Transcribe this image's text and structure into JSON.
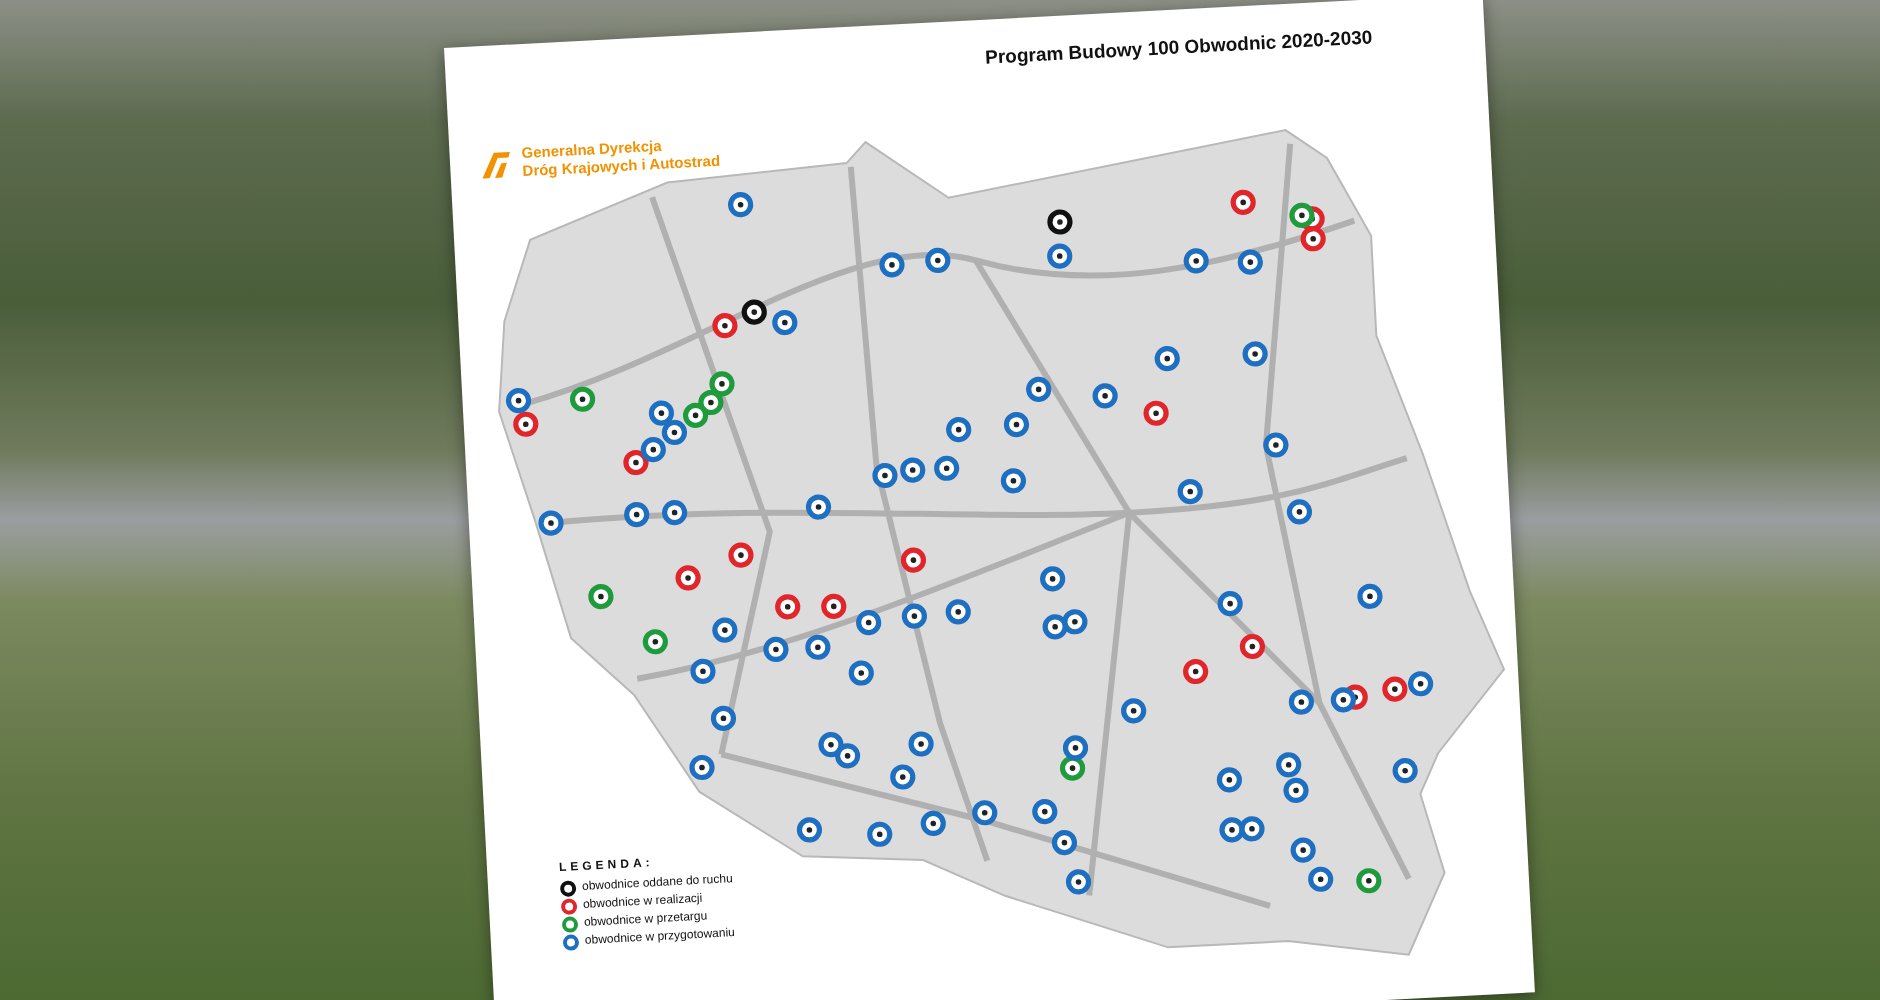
{
  "poster": {
    "title": "Program Budowy 100 Obwodnic 2020-2030",
    "logo": {
      "lines": [
        "Generalna Dyrekcja",
        "Dróg Krajowych i Autostrad"
      ]
    },
    "legend": {
      "title": "LEGENDA:",
      "items": [
        {
          "kind": "open",
          "label": "obwodnice oddane do ruchu",
          "color": "#111111"
        },
        {
          "kind": "construction",
          "label": "obwodnice w realizacji",
          "color": "#e0262b"
        },
        {
          "kind": "tender",
          "label": "obwodnice w przetargu",
          "color": "#1f9a3c"
        },
        {
          "kind": "preparation",
          "label": "obwodnice w przygotowaniu",
          "color": "#1f6fc0"
        }
      ]
    },
    "markers": [
      {
        "kind": "open"
      },
      {
        "kind": "open"
      },
      {
        "kind": "construction"
      },
      {
        "kind": "construction"
      },
      {
        "kind": "construction"
      },
      {
        "kind": "construction"
      },
      {
        "kind": "construction"
      },
      {
        "kind": "construction"
      },
      {
        "kind": "construction"
      },
      {
        "kind": "construction"
      },
      {
        "kind": "construction"
      },
      {
        "kind": "construction"
      },
      {
        "kind": "construction"
      },
      {
        "kind": "construction"
      },
      {
        "kind": "construction"
      },
      {
        "kind": "construction"
      },
      {
        "kind": "construction"
      },
      {
        "kind": "construction"
      },
      {
        "kind": "tender"
      },
      {
        "kind": "tender"
      },
      {
        "kind": "tender"
      },
      {
        "kind": "tender"
      },
      {
        "kind": "tender"
      },
      {
        "kind": "tender"
      },
      {
        "kind": "tender"
      },
      {
        "kind": "tender"
      },
      {
        "kind": "tender"
      },
      {
        "kind": "preparation"
      },
      {
        "kind": "preparation"
      },
      {
        "kind": "preparation"
      },
      {
        "kind": "preparation"
      },
      {
        "kind": "preparation"
      },
      {
        "kind": "preparation"
      },
      {
        "kind": "preparation"
      },
      {
        "kind": "preparation"
      },
      {
        "kind": "preparation"
      },
      {
        "kind": "preparation"
      },
      {
        "kind": "preparation"
      },
      {
        "kind": "preparation"
      },
      {
        "kind": "preparation"
      },
      {
        "kind": "preparation"
      },
      {
        "kind": "preparation"
      },
      {
        "kind": "preparation"
      },
      {
        "kind": "preparation"
      },
      {
        "kind": "preparation"
      },
      {
        "kind": "preparation"
      },
      {
        "kind": "preparation"
      },
      {
        "kind": "preparation"
      },
      {
        "kind": "preparation"
      },
      {
        "kind": "preparation"
      },
      {
        "kind": "preparation"
      },
      {
        "kind": "preparation"
      },
      {
        "kind": "preparation"
      },
      {
        "kind": "preparation"
      },
      {
        "kind": "preparation"
      },
      {
        "kind": "preparation"
      },
      {
        "kind": "preparation"
      },
      {
        "kind": "preparation"
      },
      {
        "kind": "preparation"
      },
      {
        "kind": "preparation"
      },
      {
        "kind": "preparation"
      },
      {
        "kind": "preparation"
      },
      {
        "kind": "preparation"
      },
      {
        "kind": "preparation"
      },
      {
        "kind": "preparation"
      },
      {
        "kind": "preparation"
      },
      {
        "kind": "preparation"
      },
      {
        "kind": "preparation"
      },
      {
        "kind": "preparation"
      },
      {
        "kind": "preparation"
      },
      {
        "kind": "preparation"
      },
      {
        "kind": "preparation"
      },
      {
        "kind": "preparation"
      },
      {
        "kind": "preparation"
      },
      {
        "kind": "preparation"
      },
      {
        "kind": "preparation"
      },
      {
        "kind": "preparation"
      },
      {
        "kind": "preparation"
      },
      {
        "kind": "preparation"
      },
      {
        "kind": "preparation"
      },
      {
        "kind": "preparation"
      },
      {
        "kind": "preparation"
      },
      {
        "kind": "preparation"
      },
      {
        "kind": "preparation"
      },
      {
        "kind": "preparation"
      },
      {
        "kind": "preparation"
      },
      {
        "kind": "preparation"
      },
      {
        "kind": "preparation"
      },
      {
        "kind": "preparation"
      },
      {
        "kind": "preparation"
      },
      {
        "kind": "preparation"
      },
      {
        "kind": "preparation"
      },
      {
        "kind": "preparation"
      },
      {
        "kind": "preparation"
      }
    ]
  }
}
